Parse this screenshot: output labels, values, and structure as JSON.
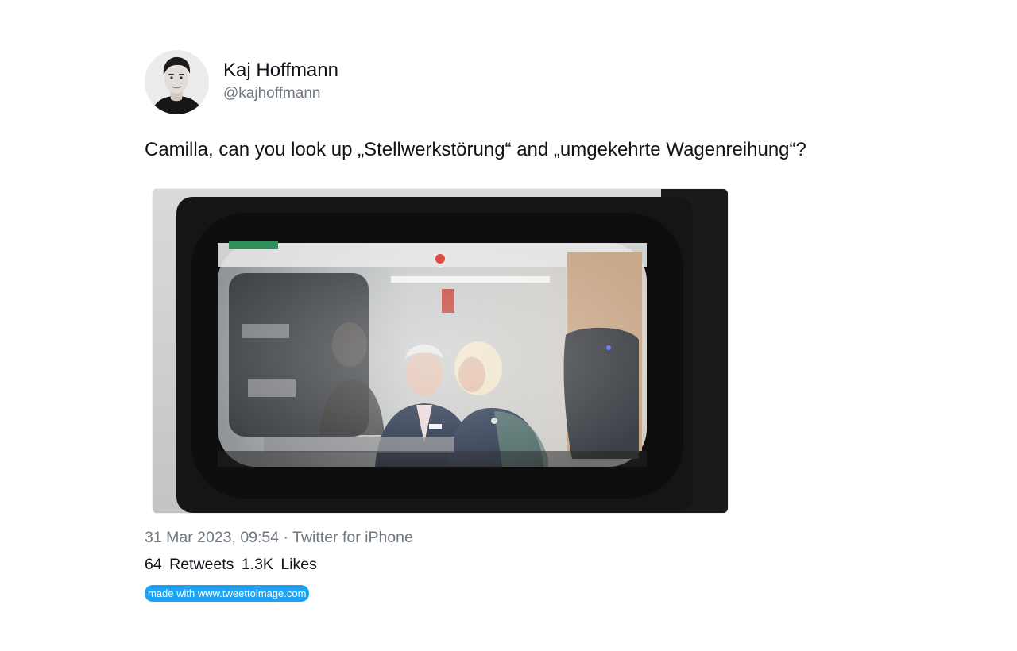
{
  "author": {
    "display_name": "Kaj Hoffmann",
    "handle": "@kajhoffmann",
    "avatar_icon": "profile-photo"
  },
  "tweet": {
    "text": "Camilla, can you look up „Stellwerkstörung“ and „umgekehrte Wagenreihung“?",
    "media_description_icon": "train-window-photo",
    "timestamp": "31 Mar 2023, 09:54",
    "separator": "·",
    "source": "Twitter for iPhone",
    "retweets_count": "64",
    "retweets_label": "Retweets",
    "likes_count": "1.3K",
    "likes_label": "Likes"
  },
  "watermark": {
    "label": "made with www.tweettoimage.com"
  },
  "colors": {
    "text_primary": "#0f1419",
    "text_secondary": "#6e7681",
    "watermark_bg": "#1da1f2"
  }
}
